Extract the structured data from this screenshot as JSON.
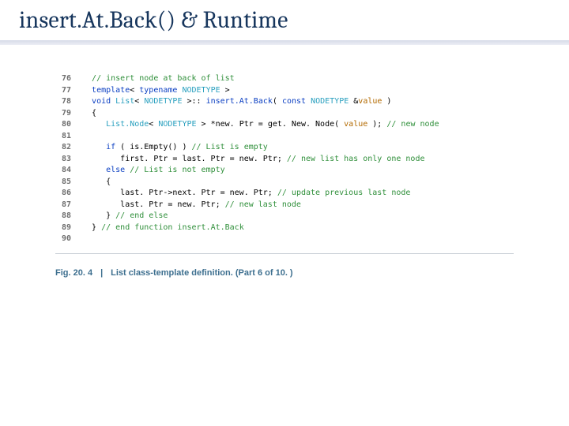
{
  "title": "insert.At.Back() & Runtime",
  "code": {
    "lines": [
      {
        "n": "76",
        "ind": "  ",
        "segs": [
          {
            "c": "cmt",
            "t": "// insert node at back of list"
          }
        ]
      },
      {
        "n": "77",
        "ind": "  ",
        "segs": [
          {
            "c": "kw",
            "t": "template"
          },
          {
            "c": "",
            "t": "< "
          },
          {
            "c": "kw",
            "t": "typename"
          },
          {
            "c": "",
            "t": " "
          },
          {
            "c": "typ",
            "t": "NODETYPE"
          },
          {
            "c": "",
            "t": " >"
          }
        ]
      },
      {
        "n": "78",
        "ind": "  ",
        "segs": [
          {
            "c": "kw",
            "t": "void"
          },
          {
            "c": "",
            "t": " "
          },
          {
            "c": "typ",
            "t": "List"
          },
          {
            "c": "",
            "t": "< "
          },
          {
            "c": "typ",
            "t": "NODETYPE"
          },
          {
            "c": "",
            "t": " >:: "
          },
          {
            "c": "fn",
            "t": "insert.At.Back"
          },
          {
            "c": "",
            "t": "( "
          },
          {
            "c": "kw",
            "t": "const"
          },
          {
            "c": "",
            "t": " "
          },
          {
            "c": "typ",
            "t": "NODETYPE"
          },
          {
            "c": "",
            "t": " &"
          },
          {
            "c": "par",
            "t": "value"
          },
          {
            "c": "",
            "t": " )"
          }
        ]
      },
      {
        "n": "79",
        "ind": "  ",
        "segs": [
          {
            "c": "",
            "t": "{"
          }
        ]
      },
      {
        "n": "80",
        "ind": "     ",
        "segs": [
          {
            "c": "typ",
            "t": "List.Node"
          },
          {
            "c": "",
            "t": "< "
          },
          {
            "c": "typ",
            "t": "NODETYPE"
          },
          {
            "c": "",
            "t": " > *new. Ptr = get. New. Node( "
          },
          {
            "c": "par",
            "t": "value"
          },
          {
            "c": "",
            "t": " ); "
          },
          {
            "c": "cmt",
            "t": "// new node"
          }
        ]
      },
      {
        "n": "81",
        "ind": "",
        "segs": [
          {
            "c": "",
            "t": ""
          }
        ]
      },
      {
        "n": "82",
        "ind": "     ",
        "segs": [
          {
            "c": "kw",
            "t": "if"
          },
          {
            "c": "",
            "t": " ( is.Empty() ) "
          },
          {
            "c": "cmt",
            "t": "// List is empty"
          }
        ]
      },
      {
        "n": "83",
        "ind": "        ",
        "segs": [
          {
            "c": "",
            "t": "first. Ptr = last. Ptr = new. Ptr; "
          },
          {
            "c": "cmt",
            "t": "// new list has only one node"
          }
        ]
      },
      {
        "n": "84",
        "ind": "     ",
        "segs": [
          {
            "c": "kw",
            "t": "else"
          },
          {
            "c": "",
            "t": " "
          },
          {
            "c": "cmt",
            "t": "// List is not empty"
          }
        ]
      },
      {
        "n": "85",
        "ind": "     ",
        "segs": [
          {
            "c": "",
            "t": "{"
          }
        ]
      },
      {
        "n": "86",
        "ind": "        ",
        "segs": [
          {
            "c": "",
            "t": "last. Ptr->next. Ptr = new. Ptr; "
          },
          {
            "c": "cmt",
            "t": "// update previous last node"
          }
        ]
      },
      {
        "n": "87",
        "ind": "        ",
        "segs": [
          {
            "c": "",
            "t": "last. Ptr = new. Ptr; "
          },
          {
            "c": "cmt",
            "t": "// new last node"
          }
        ]
      },
      {
        "n": "88",
        "ind": "     ",
        "segs": [
          {
            "c": "",
            "t": "} "
          },
          {
            "c": "cmt",
            "t": "// end else"
          }
        ]
      },
      {
        "n": "89",
        "ind": "  ",
        "segs": [
          {
            "c": "",
            "t": "} "
          },
          {
            "c": "cmt",
            "t": "// end function insert.At.Back"
          }
        ]
      },
      {
        "n": "90",
        "ind": "",
        "segs": [
          {
            "c": "",
            "t": ""
          }
        ]
      }
    ]
  },
  "caption": {
    "fig_label": "Fig. 20. 4",
    "separator": "|",
    "text": "List class-template definition. (Part 6 of 10. )"
  }
}
